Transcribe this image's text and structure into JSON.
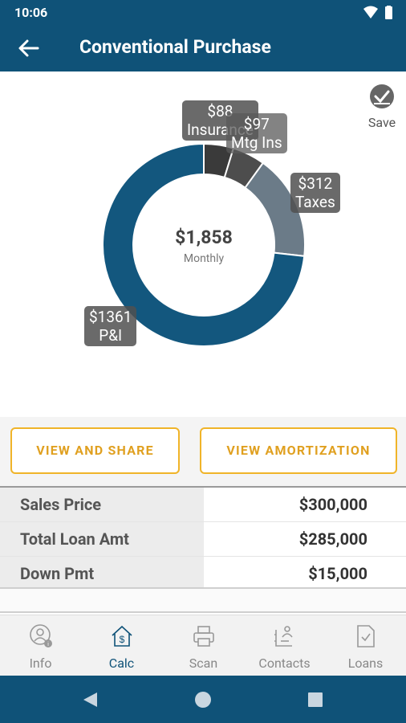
{
  "status_bar": {
    "time": "10:06"
  },
  "app_bar": {
    "title": "Conventional Purchase",
    "back_icon": "back-arrow-icon"
  },
  "save": {
    "label": "Save",
    "icon": "check-circle-icon"
  },
  "payment_chart": {
    "center_amount": "$1,858",
    "center_label": "Monthly",
    "segments": [
      {
        "label": "Insurance",
        "amount": "$88",
        "value": 88,
        "color": "#3a3a3a"
      },
      {
        "label": "Mtg Ins",
        "amount": "$97",
        "value": 97,
        "color": "#4d4d4d"
      },
      {
        "label": "Taxes",
        "amount": "$312",
        "value": 312,
        "color": "#6b7b88"
      },
      {
        "label": "P&I",
        "amount": "$1361",
        "value": 1361,
        "color": "#13577e"
      }
    ]
  },
  "actions": {
    "view_share": "VIEW AND SHARE",
    "view_amortization": "VIEW AMORTIZATION"
  },
  "summary": {
    "rows": [
      {
        "label": "Sales Price",
        "value": "$300,000"
      },
      {
        "label": "Total Loan Amt",
        "value": "$285,000"
      },
      {
        "label": "Down Pmt",
        "value": "$15,000"
      }
    ]
  },
  "bottom_nav": {
    "items": [
      {
        "label": "Info",
        "icon": "person-info-icon",
        "active": false
      },
      {
        "label": "Calc",
        "icon": "house-dollar-icon",
        "active": true
      },
      {
        "label": "Scan",
        "icon": "printer-icon",
        "active": false
      },
      {
        "label": "Contacts",
        "icon": "contacts-icon",
        "active": false
      },
      {
        "label": "Loans",
        "icon": "document-check-icon",
        "active": false
      }
    ]
  },
  "colors": {
    "primary": "#0f5278",
    "accent": "#f0b429"
  }
}
